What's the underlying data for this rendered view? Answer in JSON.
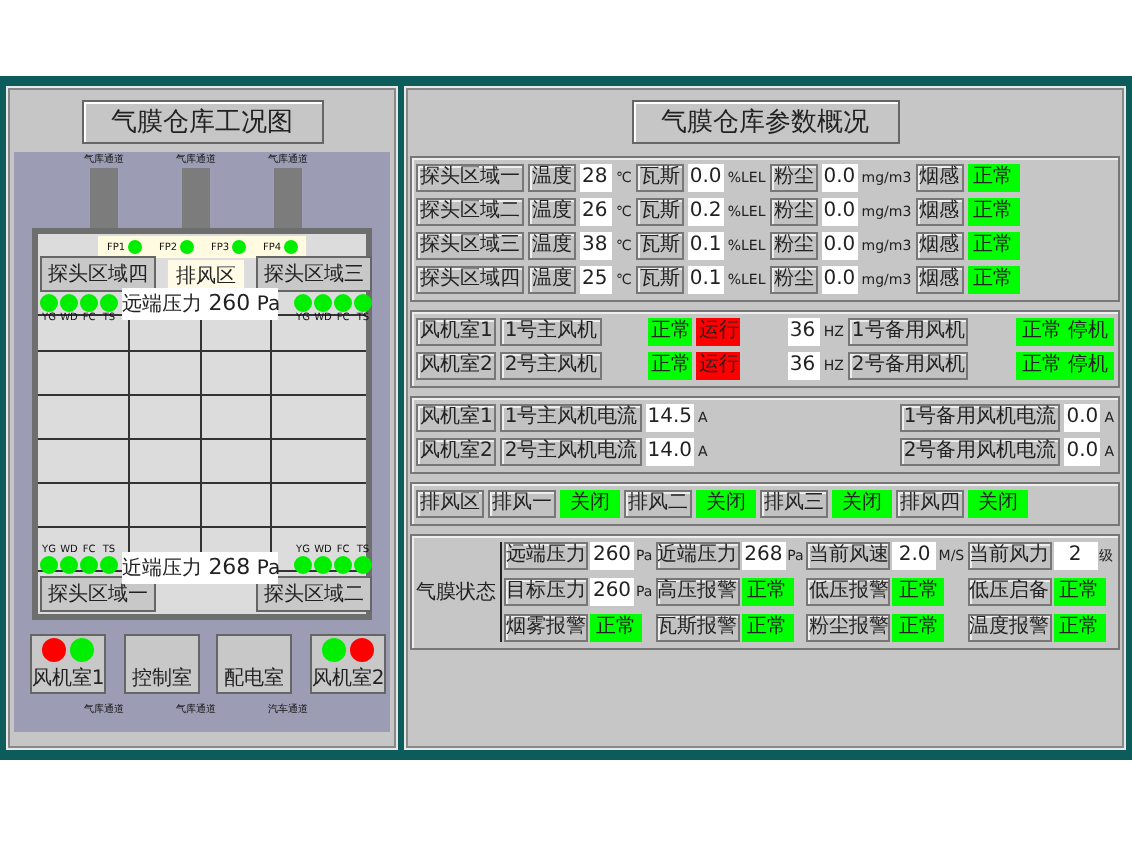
{
  "left": {
    "title": "气膜仓库工况图",
    "top_channels": [
      "气库通道",
      "气库通道",
      "气库通道"
    ],
    "bottom_channels": [
      "气库通道",
      "气库通道",
      "汽车通道"
    ],
    "exhaust_label": "排风区",
    "fans": [
      {
        "label": "FP1",
        "color": "#00ee00"
      },
      {
        "label": "FP2",
        "color": "#00ee00"
      },
      {
        "label": "FP3",
        "color": "#00ee00"
      },
      {
        "label": "FP4",
        "color": "#00ee00"
      }
    ],
    "zones": [
      {
        "label": "探头区域四",
        "lights": [
          {
            "label": "YG",
            "color": "#00ee00"
          },
          {
            "label": "WD",
            "color": "#00ee00"
          },
          {
            "label": "FC",
            "color": "#00ee00"
          },
          {
            "label": "TS",
            "color": "#00ee00"
          }
        ]
      },
      {
        "label": "探头区域三",
        "lights": [
          {
            "label": "YG",
            "color": "#00ee00"
          },
          {
            "label": "WD",
            "color": "#00ee00"
          },
          {
            "label": "FC",
            "color": "#00ee00"
          },
          {
            "label": "TS",
            "color": "#00ee00"
          }
        ]
      },
      {
        "label": "探头区域一",
        "lights": [
          {
            "label": "YG",
            "color": "#00ee00"
          },
          {
            "label": "WD",
            "color": "#00ee00"
          },
          {
            "label": "FC",
            "color": "#00ee00"
          },
          {
            "label": "TS",
            "color": "#00ee00"
          }
        ]
      },
      {
        "label": "探头区域二",
        "lights": [
          {
            "label": "YG",
            "color": "#00ee00"
          },
          {
            "label": "WD",
            "color": "#00ee00"
          },
          {
            "label": "FC",
            "color": "#00ee00"
          },
          {
            "label": "TS",
            "color": "#00ee00"
          }
        ]
      }
    ],
    "far": {
      "label": "远端压力",
      "value": "260",
      "unit": "Pa"
    },
    "near": {
      "label": "近端压力",
      "value": "268",
      "unit": "Pa"
    },
    "rooms": [
      {
        "label": "风机室1",
        "lights": [
          {
            "color": "#ff0000"
          },
          {
            "color": "#00ee00"
          }
        ]
      },
      {
        "label": "控制室"
      },
      {
        "label": "配电室"
      },
      {
        "label": "风机室2",
        "lights": [
          {
            "color": "#00ee00"
          },
          {
            "color": "#ff0000"
          }
        ]
      }
    ]
  },
  "right": {
    "title": "气膜仓库参数概况",
    "sensors": [
      {
        "zone": "探头区域一",
        "temp_label": "温度",
        "temp": "28",
        "temp_unit": "℃",
        "gas_label": "瓦斯",
        "gas": "0.0",
        "gas_unit": "%LEL",
        "dust_label": "粉尘",
        "dust": "0.0",
        "dust_unit": "mg/m3",
        "smoke_label": "烟感",
        "smoke": "正常",
        "color": "#00ff00"
      },
      {
        "zone": "探头区域二",
        "temp_label": "温度",
        "temp": "26",
        "temp_unit": "℃",
        "gas_label": "瓦斯",
        "gas": "0.2",
        "gas_unit": "%LEL",
        "dust_label": "粉尘",
        "dust": "0.0",
        "dust_unit": "mg/m3",
        "smoke_label": "烟感",
        "smoke": "正常",
        "color": "#00ff00"
      },
      {
        "zone": "探头区域三",
        "temp_label": "温度",
        "temp": "38",
        "temp_unit": "℃",
        "gas_label": "瓦斯",
        "gas": "0.1",
        "gas_unit": "%LEL",
        "dust_label": "粉尘",
        "dust": "0.0",
        "dust_unit": "mg/m3",
        "smoke_label": "烟感",
        "smoke": "正常",
        "color": "#00ff00"
      },
      {
        "zone": "探头区域四",
        "temp_label": "温度",
        "temp": "25",
        "temp_unit": "℃",
        "gas_label": "瓦斯",
        "gas": "0.1",
        "gas_unit": "%LEL",
        "dust_label": "粉尘",
        "dust": "0.0",
        "dust_unit": "mg/m3",
        "smoke_label": "烟感",
        "smoke": "正常",
        "color": "#00ff00"
      }
    ],
    "fans": [
      {
        "room": "风机室1",
        "main": "1号主风机",
        "run": [
          {
            "text": "正常",
            "color": "#00ff00"
          },
          {
            "text": "运行",
            "color": "#ff0000"
          }
        ],
        "freq": "36",
        "freq_unit": "HZ",
        "backup": "1号备用风机",
        "backup_status": {
          "text": "正常 停机",
          "color": "#00ff00"
        }
      },
      {
        "room": "风机室2",
        "main": "2号主风机",
        "run": [
          {
            "text": "正常",
            "color": "#00ff00"
          },
          {
            "text": "运行",
            "color": "#ff0000"
          }
        ],
        "freq": "36",
        "freq_unit": "HZ",
        "backup": "2号备用风机",
        "backup_status": {
          "text": "正常 停机",
          "color": "#00ff00"
        }
      }
    ],
    "currents": [
      {
        "room": "风机室1",
        "main_label": "1号主风机电流",
        "main_value": "14.5",
        "main_unit": "A",
        "backup_label": "1号备用风机电流",
        "backup_value": "0.0",
        "backup_unit": "A"
      },
      {
        "room": "风机室2",
        "main_label": "2号主风机电流",
        "main_value": "14.0",
        "main_unit": "A",
        "backup_label": "2号备用风机电流",
        "backup_value": "0.0",
        "backup_unit": "A"
      }
    ],
    "exhaust": {
      "label": "排风区",
      "items": [
        {
          "label": "排风一",
          "status": "关闭",
          "color": "#00ff00"
        },
        {
          "label": "排风二",
          "status": "关闭",
          "color": "#00ff00"
        },
        {
          "label": "排风三",
          "status": "关闭",
          "color": "#00ff00"
        },
        {
          "label": "排风四",
          "status": "关闭",
          "color": "#00ff00"
        }
      ]
    },
    "membrane": {
      "label": "气膜状态",
      "rows": [
        [
          {
            "label": "远端压力",
            "kind": "value",
            "value": "260",
            "unit": "Pa"
          },
          {
            "label": "近端压力",
            "kind": "value",
            "value": "268",
            "unit": "Pa"
          },
          {
            "label": "当前风速",
            "kind": "value",
            "value": "2.0",
            "unit": "M/S"
          },
          {
            "label": "当前风力",
            "kind": "value",
            "value": "2",
            "unit": "级"
          }
        ],
        [
          {
            "label": "目标压力",
            "kind": "value",
            "value": "260",
            "unit": "Pa"
          },
          {
            "label": "高压报警",
            "kind": "status",
            "value": "正常",
            "color": "#00ff00"
          },
          {
            "label": "低压报警",
            "kind": "status",
            "value": "正常",
            "color": "#00ff00"
          },
          {
            "label": "低压启备",
            "kind": "status",
            "value": "正常",
            "color": "#00ff00"
          }
        ],
        [
          {
            "label": "烟雾报警",
            "kind": "status",
            "value": "正常",
            "color": "#00ff00"
          },
          {
            "label": "瓦斯报警",
            "kind": "status",
            "value": "正常",
            "color": "#00ff00"
          },
          {
            "label": "粉尘报警",
            "kind": "status",
            "value": "正常",
            "color": "#00ff00"
          },
          {
            "label": "温度报警",
            "kind": "status",
            "value": "正常",
            "color": "#00ff00"
          }
        ]
      ]
    }
  }
}
